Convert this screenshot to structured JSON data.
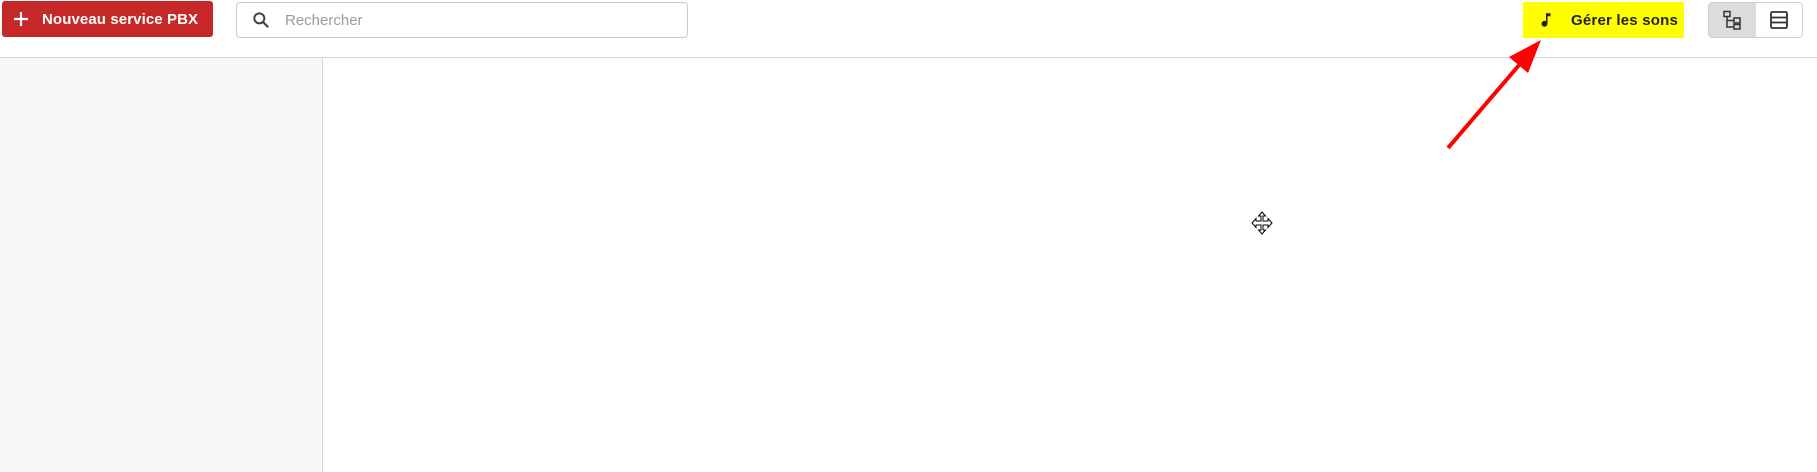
{
  "toolbar": {
    "new_service_label": "Nouveau service PBX",
    "search_placeholder": "Rechercher",
    "search_value": "",
    "manage_sounds_label": "Gérer les sons"
  },
  "view_toggle": {
    "options": [
      {
        "name": "diagram-view",
        "active": true
      },
      {
        "name": "list-view",
        "active": false
      }
    ]
  },
  "colors": {
    "primary_red": "#c62828",
    "highlight_yellow": "#ffff00",
    "annotation_arrow": "#ff0000"
  },
  "icons": {
    "new_service": "plus-icon",
    "search": "search-icon",
    "manage_sounds": "music-note-icon",
    "diagram_view": "sitemap-icon",
    "list_view": "list-icon",
    "cursor": "move-cursor-icon"
  }
}
